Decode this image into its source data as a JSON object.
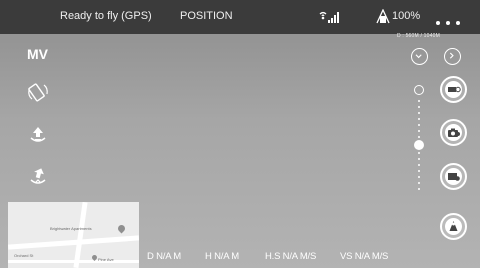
{
  "status_bar": {
    "flight_status": "Ready to fly (GPS)",
    "flight_mode": "POSITION",
    "battery_percent": "100%"
  },
  "left_controls": {
    "mode_label": "MV"
  },
  "right_controls": {
    "distance_readout": "D : 560M / 1040M"
  },
  "map": {
    "place_label": "Brightwater Apartments",
    "street_label": "Orchard St",
    "road_label": "Pine Ave"
  },
  "telemetry": {
    "distance": "D N/A M",
    "height": "H N/A M",
    "horizontal_speed": "H.S N/A M/S",
    "vertical_speed": "VS  N/A M/S"
  },
  "colors": {
    "status_bar_bg": "#3b3b3b",
    "camera_bg": "#a6a6a6",
    "icon_color": "#ffffff"
  },
  "icons": [
    "satellite-signal-icon",
    "battery-icon",
    "more-icon",
    "orientation-icon",
    "takeoff-icon",
    "return-home-icon",
    "chevron-down-icon",
    "chevron-right-icon",
    "video-mode-icon",
    "camera-icon",
    "playback-icon",
    "map-toggle-icon"
  ]
}
